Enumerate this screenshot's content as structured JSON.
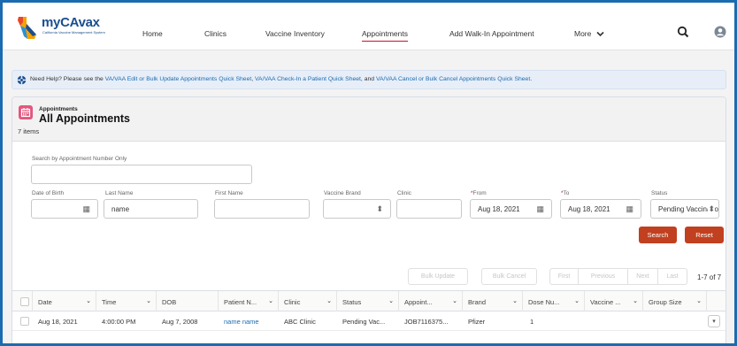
{
  "header": {
    "logo_text": "myCAvax",
    "logo_tagline": "California Vaccine Management System",
    "nav": [
      "Home",
      "Clinics",
      "Vaccine Inventory",
      "Appointments",
      "Add Walk-In Appointment",
      "More"
    ],
    "active_nav": "Appointments"
  },
  "help": {
    "prefix": "Need Help? Please see the ",
    "link1": "VA/VAA Edit or Bulk Update Appointments Quick Sheet",
    "sep1": ", ",
    "link2": "VA/VAA Check-In a Patient Quick Sheet",
    "sep2": ", and ",
    "link3": "VA/VAA Cancel or Bulk Cancel Appointments Quick Sheet",
    "suffix": "."
  },
  "page": {
    "breadcrumb": "Appointments",
    "title": "All Appointments",
    "item_count": "7 items"
  },
  "filters": {
    "search_label": "Search by Appointment Number Only",
    "search_value": "",
    "dob_label": "Date of Birth",
    "last_name_label": "Last Name",
    "last_name_value": "name",
    "first_name_label": "First Name",
    "brand_label": "Vaccine Brand",
    "clinic_label": "Clinic",
    "from_label": "From",
    "from_value": "Aug 18, 2021",
    "to_label": "To",
    "to_value": "Aug 18, 2021",
    "status_label": "Status",
    "status_value": "Pending Vaccination",
    "required_mark": "*"
  },
  "actions": {
    "search": "Search",
    "reset": "Reset",
    "bulk_update": "Bulk Update",
    "bulk_cancel": "Bulk Cancel",
    "first": "First",
    "previous": "Previous",
    "next": "Next",
    "last": "Last",
    "range": "1-7 of 7"
  },
  "table": {
    "columns": [
      "Date",
      "Time",
      "DOB",
      "Patient N...",
      "Clinic",
      "Status",
      "Appoint...",
      "Brand",
      "Dose Nu...",
      "Vaccine ...",
      "Group Size"
    ],
    "rows": [
      [
        "Aug 18, 2021",
        "4:00:00 PM",
        "Aug 7, 2008",
        "name name",
        "ABC Clinic",
        "Pending Vac...",
        "JOB7116375...",
        "Pfizer",
        "1",
        "",
        ""
      ]
    ]
  },
  "colors": {
    "accent_blue": "#1a6bb0",
    "brand_red": "#c1401f",
    "icon_pink": "#e3567d"
  }
}
